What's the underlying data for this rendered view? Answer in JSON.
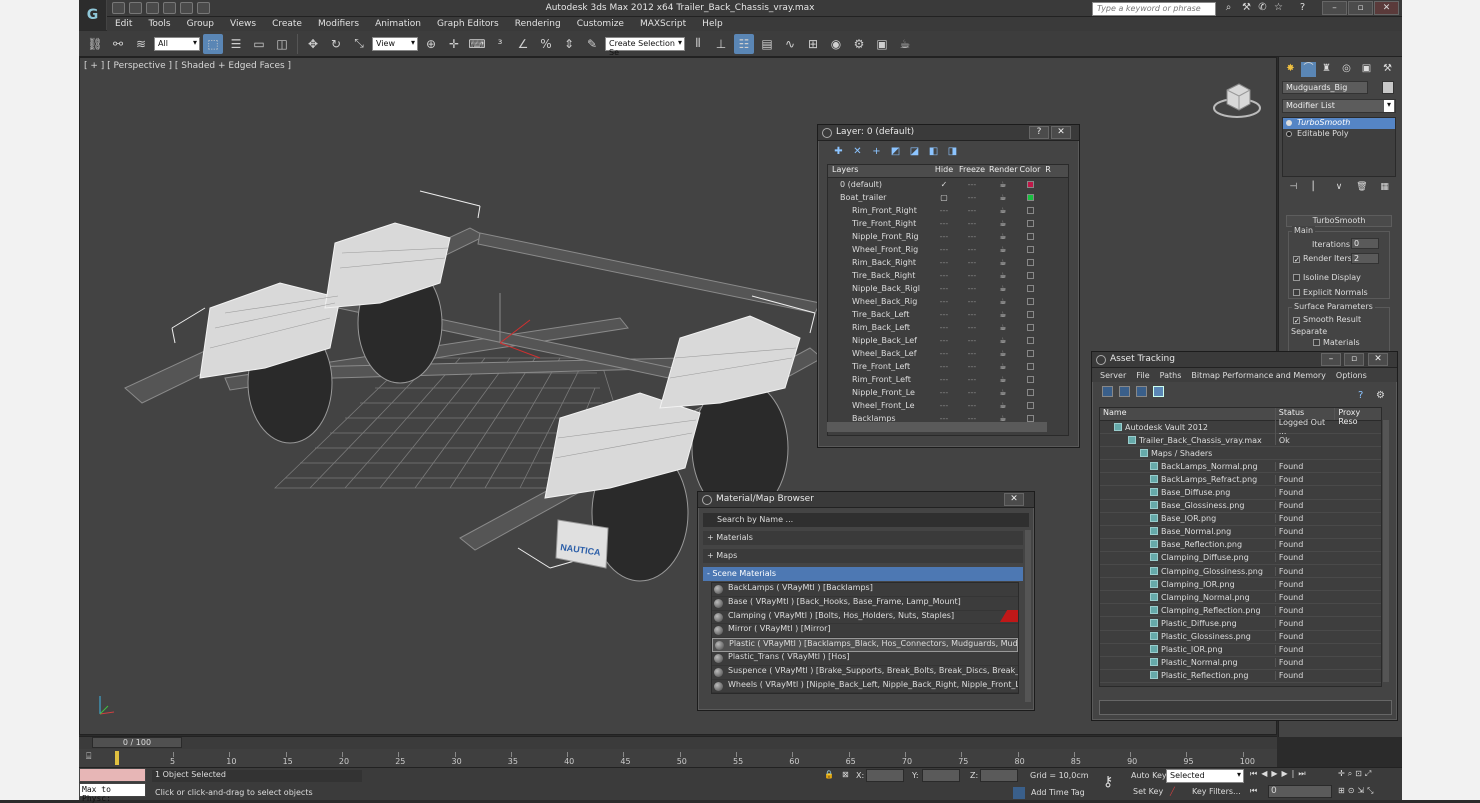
{
  "app": {
    "title": "Autodesk 3ds Max  2012 x64      Trailer_Back_Chassis_vray.max",
    "logo_letter": "G",
    "search_placeholder": "Type a keyword or phrase"
  },
  "menu": [
    "Edit",
    "Tools",
    "Group",
    "Views",
    "Create",
    "Modifiers",
    "Animation",
    "Graph Editors",
    "Rendering",
    "Customize",
    "MAXScript",
    "Help"
  ],
  "toolbar": {
    "selection_filter": "All",
    "ref_coord": "View",
    "named_selection": "Create Selection Se"
  },
  "viewport": {
    "label": "[ + ] [ Perspective ] [ Shaded + Edged Faces ]",
    "decal_text": "NAUTICA"
  },
  "command_panel": {
    "object_name": "Mudguards_Big",
    "modifier_list": "Modifier List",
    "stack": [
      "TurboSmooth",
      "Editable Poly"
    ],
    "rollout_title": "TurboSmooth",
    "main_group": "Main",
    "iterations_label": "Iterations:",
    "iterations_value": "0",
    "render_iters_label": "Render Iters:",
    "render_iters_value": "2",
    "isoline_label": "Isoline Display",
    "explicit_label": "Explicit Normals",
    "surface_group": "Surface Parameters",
    "smooth_result_label": "Smooth Result",
    "separate_label": "Separate",
    "materials_label": "Materials"
  },
  "layer_window": {
    "title": "Layer: 0 (default)",
    "columns": [
      "Layers",
      "Hide",
      "Freeze",
      "Render",
      "Color",
      "R"
    ],
    "rows": [
      {
        "name": "0 (default)",
        "color": "#c01848",
        "level": 0
      },
      {
        "name": "Boat_trailer",
        "color": "#18c040",
        "level": 0
      },
      {
        "name": "Rim_Front_Right",
        "color": "",
        "level": 1
      },
      {
        "name": "Tire_Front_Right",
        "color": "",
        "level": 1
      },
      {
        "name": "Nipple_Front_Rig",
        "color": "",
        "level": 1
      },
      {
        "name": "Wheel_Front_Rig",
        "color": "",
        "level": 1
      },
      {
        "name": "Rim_Back_Right",
        "color": "",
        "level": 1
      },
      {
        "name": "Tire_Back_Right",
        "color": "",
        "level": 1
      },
      {
        "name": "Nipple_Back_Rigl",
        "color": "",
        "level": 1
      },
      {
        "name": "Wheel_Back_Rig",
        "color": "",
        "level": 1
      },
      {
        "name": "Tire_Back_Left",
        "color": "",
        "level": 1
      },
      {
        "name": "Rim_Back_Left",
        "color": "",
        "level": 1
      },
      {
        "name": "Nipple_Back_Lef",
        "color": "",
        "level": 1
      },
      {
        "name": "Wheel_Back_Lef",
        "color": "",
        "level": 1
      },
      {
        "name": "Tire_Front_Left",
        "color": "",
        "level": 1
      },
      {
        "name": "Rim_Front_Left",
        "color": "",
        "level": 1
      },
      {
        "name": "Nipple_Front_Le",
        "color": "",
        "level": 1
      },
      {
        "name": "Wheel_Front_Le",
        "color": "",
        "level": 1
      },
      {
        "name": "Backlamps",
        "color": "",
        "level": 1
      }
    ]
  },
  "material_browser": {
    "title": "Material/Map Browser",
    "search_placeholder": "Search by Name ...",
    "groups": [
      "+ Materials",
      "+ Maps",
      "- Scene Materials"
    ],
    "items": [
      "BackLamps  ( VRayMtl )  [Backlamps]",
      "Base  ( VRayMtl )  [Back_Hooks, Base_Frame, Lamp_Mount]",
      "Clamping  ( VRayMtl )  [Bolts, Hos_Holders, Nuts, Staples]",
      "Mirror  ( VRayMtl )  [Mirror]",
      "Plastic  ( VRayMtl )  [Backlamps_Black, Hos_Connectors, Mudguards, Mudguards...",
      "Plastic_Trans  ( VRayMtl )  [Hos]",
      "Suspence  ( VRayMtl )  [Brake_Supports, Break_Bolts, Break_Discs, Break_Lever,...",
      "Wheels  ( VRayMtl )  [Nipple_Back_Left, Nipple_Back_Right, Nipple_Front_Left, N..."
    ]
  },
  "asset_tracking": {
    "title": "Asset Tracking",
    "menu": [
      "Server",
      "File",
      "Paths",
      "Bitmap Performance and Memory",
      "Options"
    ],
    "columns": [
      "Name",
      "Status",
      "Proxy Reso"
    ],
    "rows": [
      {
        "name": "Autodesk Vault 2012",
        "status": "Logged Out ...",
        "level": 0
      },
      {
        "name": "Trailer_Back_Chassis_vray.max",
        "status": "Ok",
        "level": 1
      },
      {
        "name": "Maps / Shaders",
        "status": "",
        "level": 2
      },
      {
        "name": "BackLamps_Normal.png",
        "status": "Found",
        "level": 3
      },
      {
        "name": "BackLamps_Refract.png",
        "status": "Found",
        "level": 3
      },
      {
        "name": "Base_Diffuse.png",
        "status": "Found",
        "level": 3
      },
      {
        "name": "Base_Glossiness.png",
        "status": "Found",
        "level": 3
      },
      {
        "name": "Base_IOR.png",
        "status": "Found",
        "level": 3
      },
      {
        "name": "Base_Normal.png",
        "status": "Found",
        "level": 3
      },
      {
        "name": "Base_Reflection.png",
        "status": "Found",
        "level": 3
      },
      {
        "name": "Clamping_Diffuse.png",
        "status": "Found",
        "level": 3
      },
      {
        "name": "Clamping_Glossiness.png",
        "status": "Found",
        "level": 3
      },
      {
        "name": "Clamping_IOR.png",
        "status": "Found",
        "level": 3
      },
      {
        "name": "Clamping_Normal.png",
        "status": "Found",
        "level": 3
      },
      {
        "name": "Clamping_Reflection.png",
        "status": "Found",
        "level": 3
      },
      {
        "name": "Plastic_Diffuse.png",
        "status": "Found",
        "level": 3
      },
      {
        "name": "Plastic_Glossiness.png",
        "status": "Found",
        "level": 3
      },
      {
        "name": "Plastic_IOR.png",
        "status": "Found",
        "level": 3
      },
      {
        "name": "Plastic_Normal.png",
        "status": "Found",
        "level": 3
      },
      {
        "name": "Plastic_Reflection.png",
        "status": "Found",
        "level": 3
      }
    ]
  },
  "timeline": {
    "frame_label": "0 / 100",
    "ticks": [
      "5",
      "10",
      "15",
      "20",
      "25",
      "30",
      "35",
      "40",
      "45",
      "50",
      "55",
      "60",
      "65",
      "70",
      "75",
      "80",
      "85",
      "90",
      "95",
      "100"
    ]
  },
  "status": {
    "maxscript": "Max to Physc:",
    "selection": "1 Object Selected",
    "prompt": "Click or click-and-drag to select objects",
    "x_label": "X:",
    "y_label": "Y:",
    "z_label": "Z:",
    "grid": "Grid = 10,0cm",
    "add_time_tag": "Add Time Tag",
    "auto_key": "Auto Key",
    "set_key": "Set Key",
    "selected": "Selected",
    "key_filters": "Key Filters...",
    "frame": "0"
  }
}
